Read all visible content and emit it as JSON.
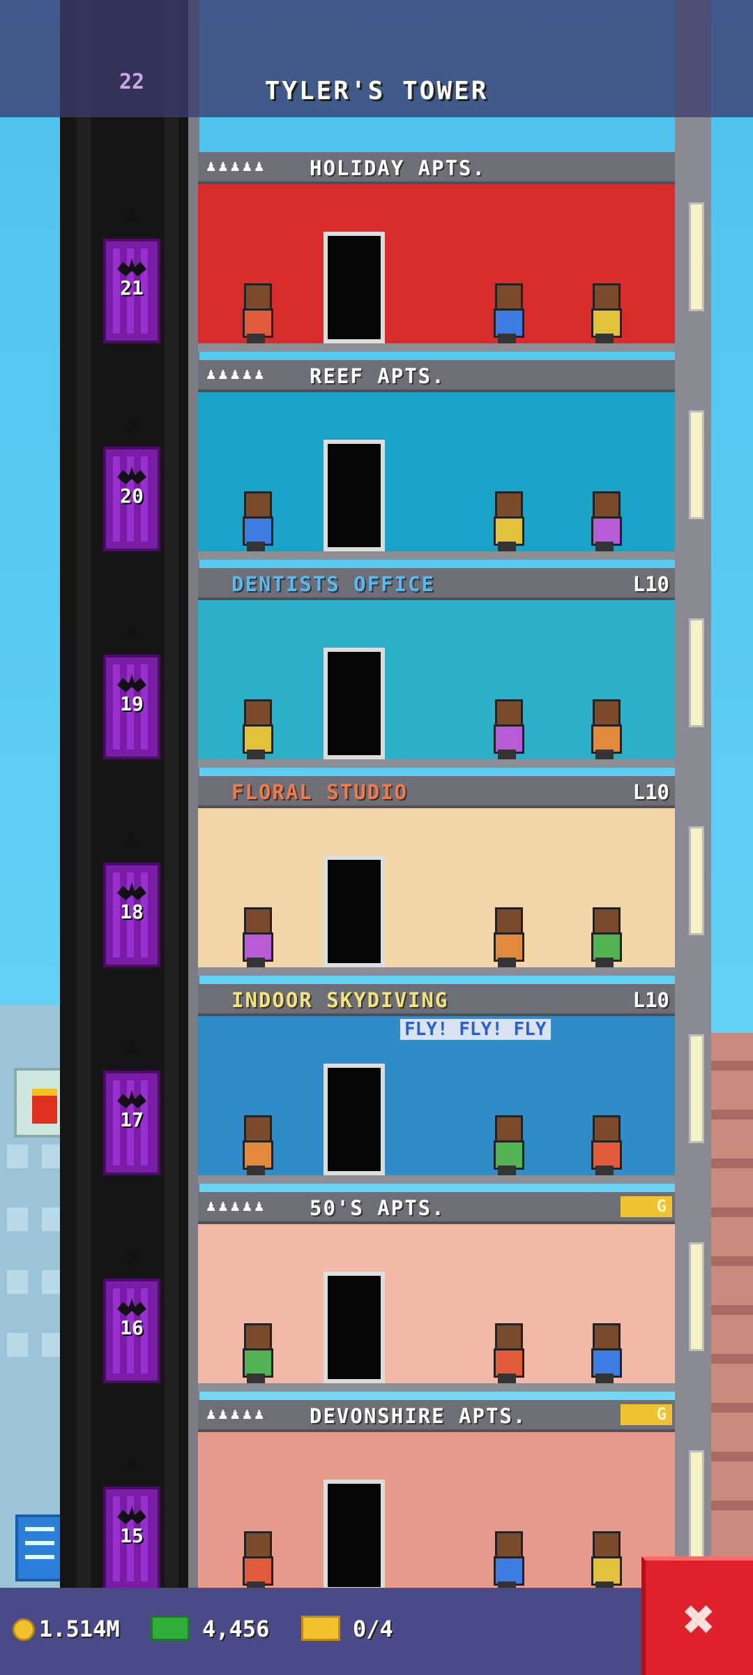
{
  "tower": {
    "name": "TYLER'S TOWER",
    "top_floor_number": "22"
  },
  "floors": [
    {
      "number": "21",
      "name": "HOLIDAY APTS.",
      "kind": "apartment",
      "tag": "",
      "label_color": "#ffffff",
      "wall": "#d92c2c"
    },
    {
      "number": "20",
      "name": "REEF APTS.",
      "kind": "apartment",
      "tag": "",
      "label_color": "#ffffff",
      "wall": "#1aa3c9"
    },
    {
      "number": "19",
      "name": "DENTISTS OFFICE",
      "kind": "business",
      "tag": "L10",
      "label_color": "#58b8f0",
      "wall": "#2ab0c8"
    },
    {
      "number": "18",
      "name": "FLORAL STUDIO",
      "kind": "business",
      "tag": "L10",
      "label_color": "#f07a4a",
      "wall": "#f2d6a8"
    },
    {
      "number": "17",
      "name": "INDOOR SKYDIVING",
      "kind": "business",
      "tag": "L10",
      "label_color": "#f4e27a",
      "wall": "#2f8cc8",
      "banner": "FLY! FLY! FLY"
    },
    {
      "number": "16",
      "name": "50'S APTS.",
      "kind": "apartment",
      "tag": "G",
      "label_color": "#ffffff",
      "wall": "#f2b9a6"
    },
    {
      "number": "15",
      "name": "DEVONSHIRE APTS.",
      "kind": "apartment",
      "tag": "G",
      "label_color": "#ffffff",
      "wall": "#e59a8c"
    }
  ],
  "stats": {
    "coins": "1.514M",
    "bux": "4,456",
    "tickets": "0/4"
  },
  "icons": {
    "coin": "coin-icon",
    "bux": "cash-icon",
    "ticket": "ticket-icon",
    "close": "close-icon"
  },
  "close_label": "✖"
}
